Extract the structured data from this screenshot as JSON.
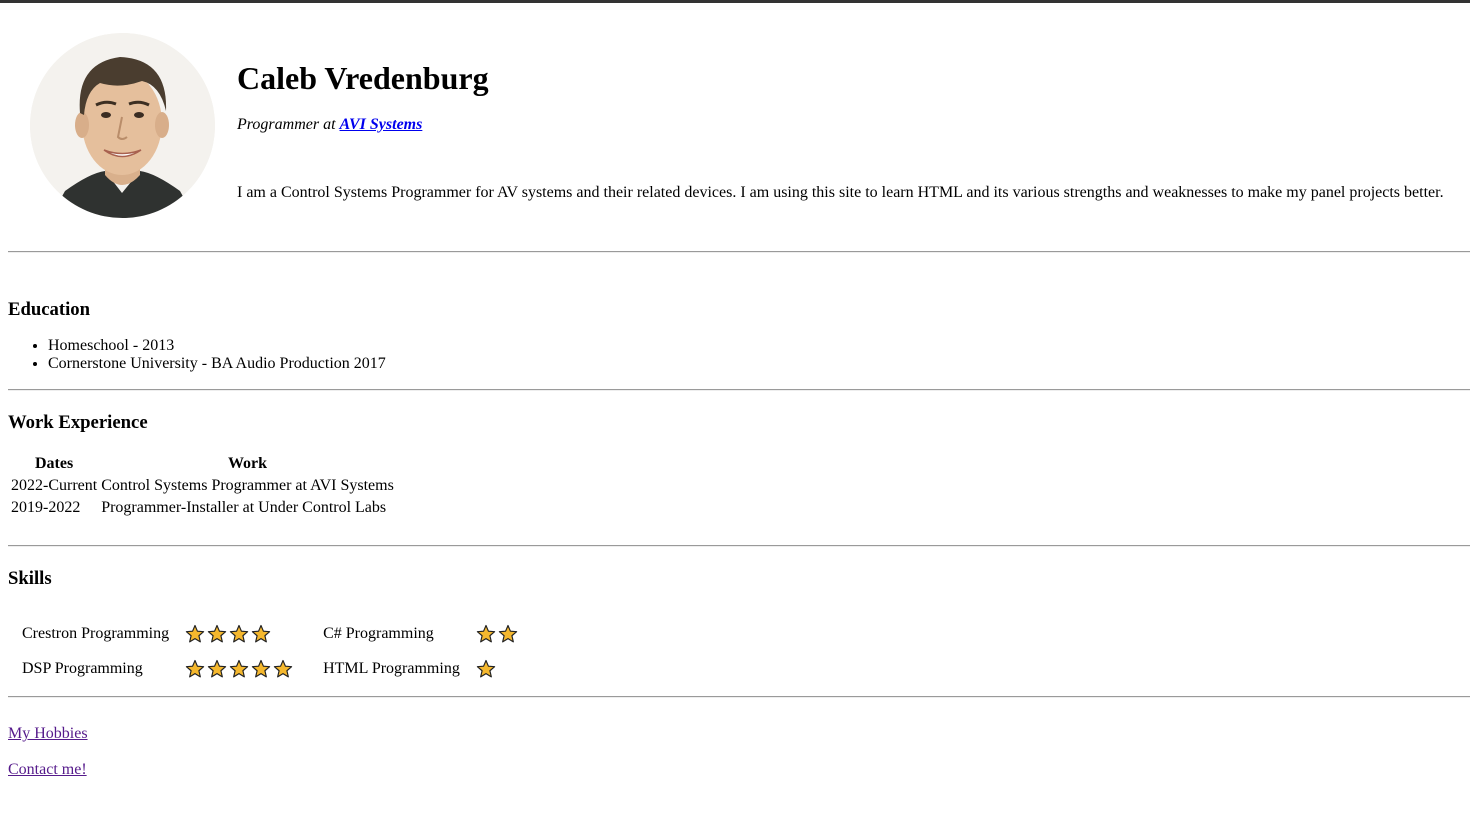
{
  "header": {
    "name": "Caleb Vredenburg",
    "role_prefix": "Programmer at",
    "company_link": "AVI Systems",
    "bio": "I am a Control Systems Programmer for AV systems and their related devices. I am using this site to learn HTML and its various strengths and weaknesses to make my panel projects better."
  },
  "education": {
    "heading": "Education",
    "items": [
      "Homeschool - 2013",
      "Cornerstone University - BA Audio Production 2017"
    ]
  },
  "work": {
    "heading": "Work Experience",
    "columns": [
      "Dates",
      "Work"
    ],
    "rows": [
      {
        "dates": "2022-Current",
        "work": "Control Systems Programmer at AVI Systems"
      },
      {
        "dates": "2019-2022",
        "work": "Programmer-Installer at Under Control Labs"
      }
    ]
  },
  "skills": {
    "heading": "Skills",
    "items": [
      {
        "label": "Crestron Programming",
        "stars": 4
      },
      {
        "label": "C# Programming",
        "stars": 2
      },
      {
        "label": "DSP Programming",
        "stars": 5
      },
      {
        "label": "HTML Programming",
        "stars": 1
      }
    ],
    "star_icon": "star-icon",
    "star_color": "#f5b82e"
  },
  "links": {
    "hobbies": "My Hobbies",
    "contact": "Contact me!"
  },
  "colors": {
    "link": "#0000ee",
    "visited_link": "#551a8b",
    "topbar": "#333333"
  }
}
